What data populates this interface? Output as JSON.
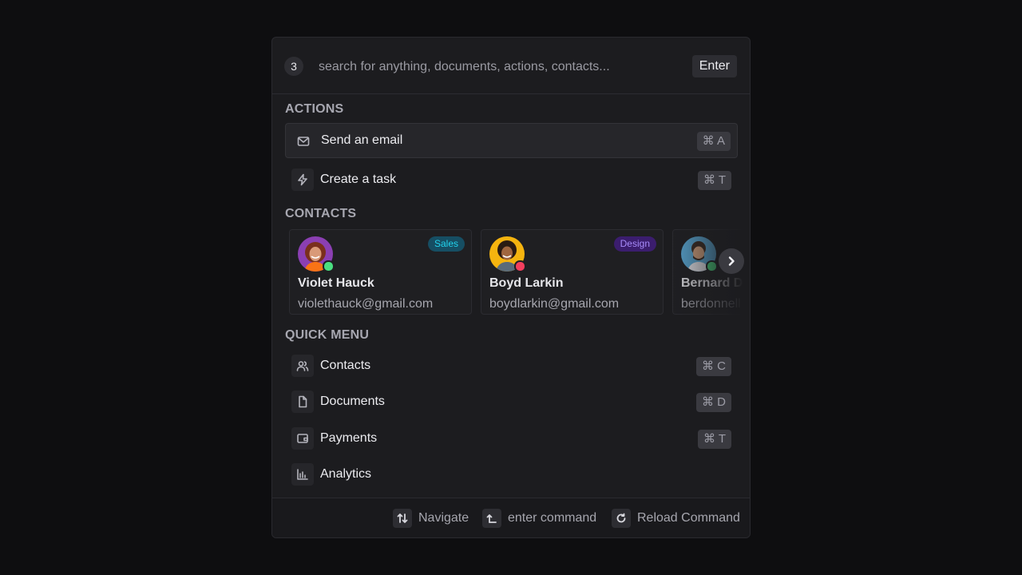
{
  "search": {
    "count": "3",
    "placeholder": "search for anything, documents, actions, contacts...",
    "submit_label": "Enter"
  },
  "actions": {
    "title": "ACTIONS",
    "items": [
      {
        "label": "Send an email",
        "shortcut": "⌘ A",
        "icon": "mail-icon"
      },
      {
        "label": "Create a task",
        "shortcut": "⌘ T",
        "icon": "lightning-icon"
      }
    ]
  },
  "contacts": {
    "title": "CONTACTS",
    "items": [
      {
        "name": "Violet Hauck",
        "email": "violethauck@gmail.com",
        "tag": "Sales",
        "status": "online",
        "status_color": "#4ade80"
      },
      {
        "name": "Boyd Larkin",
        "email": "boydlarkin@gmail.com",
        "tag": "Design",
        "status": "busy",
        "status_color": "#f43f5e"
      },
      {
        "name": "Bernard Do",
        "email": "berdonnell",
        "tag": "",
        "status": "online",
        "status_color": "#4ade80"
      }
    ]
  },
  "quick_menu": {
    "title": "QUICK MENU",
    "items": [
      {
        "label": "Contacts",
        "shortcut": "⌘ C",
        "icon": "users-icon"
      },
      {
        "label": "Documents",
        "shortcut": "⌘ D",
        "icon": "document-icon"
      },
      {
        "label": "Payments",
        "shortcut": "⌘ T",
        "icon": "wallet-icon"
      },
      {
        "label": "Analytics",
        "shortcut": "",
        "icon": "chart-icon"
      }
    ]
  },
  "footer": {
    "navigate": "Navigate",
    "enter_command": "enter command",
    "reload_command": "Reload Command"
  },
  "colors": {
    "background": "#0e0e10",
    "panel": "#1c1c1f",
    "tag_sales_bg": "#164e63",
    "tag_sales_fg": "#22d3ee",
    "tag_design_bg": "#3b1d6e",
    "tag_design_fg": "#a78bfa"
  }
}
